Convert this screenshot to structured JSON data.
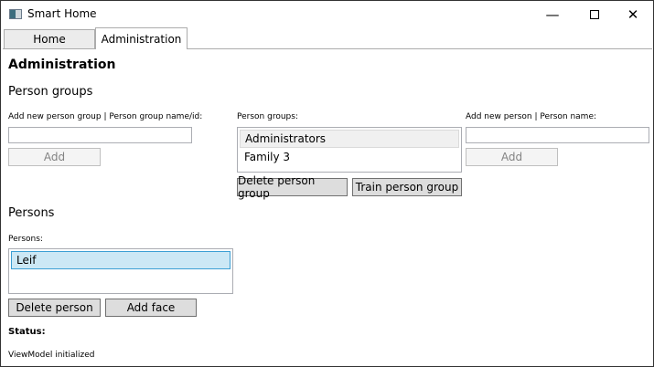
{
  "window": {
    "title": "Smart Home"
  },
  "tabs": [
    {
      "label": "Home"
    },
    {
      "label": "Administration"
    }
  ],
  "page": {
    "heading": "Administration"
  },
  "person_groups": {
    "section_title": "Person groups",
    "add_group_label": "Add new person group | Person group name/id:",
    "add_group_value": "",
    "add_group_button": "Add",
    "list_label": "Person groups:",
    "items": [
      "Administrators",
      "Family 3"
    ],
    "delete_button": "Delete person group",
    "train_button": "Train person group",
    "add_person_label": "Add new person | Person name:",
    "add_person_value": "",
    "add_person_button": "Add"
  },
  "persons": {
    "section_title": "Persons",
    "list_label": "Persons:",
    "items": [
      "Leif"
    ],
    "delete_button": "Delete person",
    "add_face_button": "Add face"
  },
  "status": {
    "label": "Status:",
    "message": "ViewModel initialized"
  }
}
